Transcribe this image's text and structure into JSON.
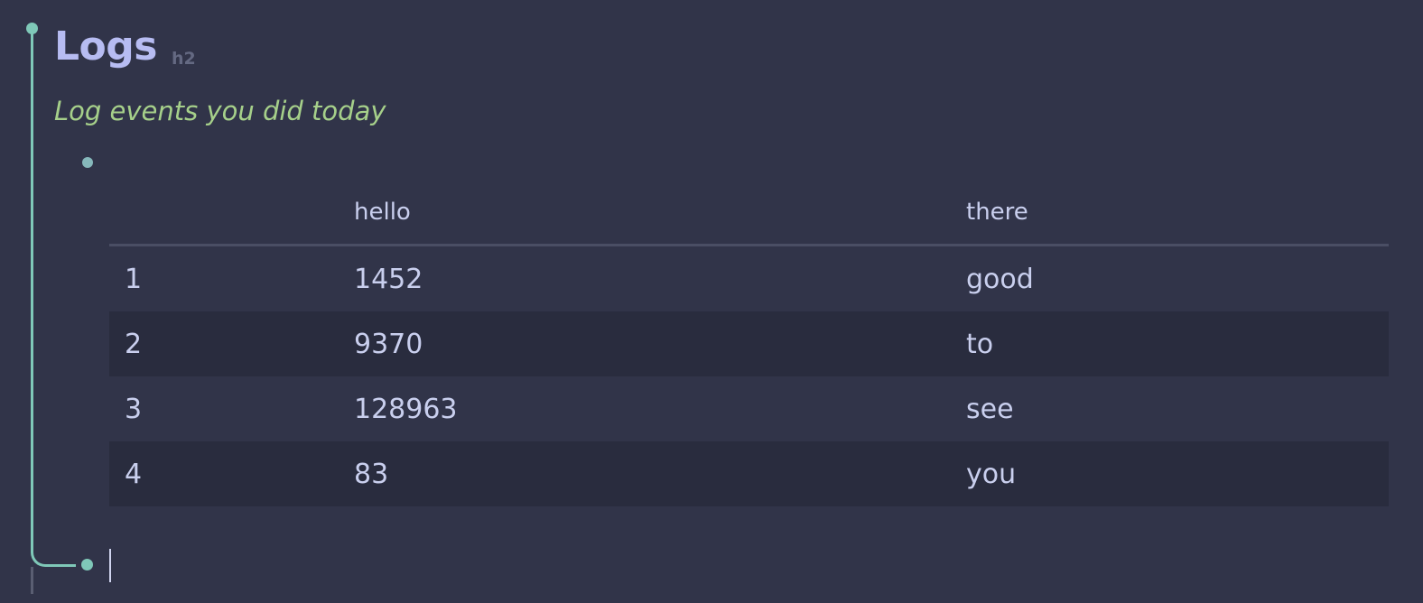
{
  "section": {
    "heading": "Logs",
    "heading_level": "h2",
    "subtitle": "Log events you did today"
  },
  "table": {
    "columns": [
      "",
      "hello",
      "there"
    ],
    "rows": [
      {
        "index": "1",
        "hello": "1452",
        "there": "good"
      },
      {
        "index": "2",
        "hello": "9370",
        "there": "to"
      },
      {
        "index": "3",
        "hello": "128963",
        "there": "see"
      },
      {
        "index": "4",
        "hello": "83",
        "there": "you"
      }
    ]
  },
  "colors": {
    "background": "#313449",
    "guide": "#7fc8b8",
    "heading": "#b7bcf2",
    "subtitle": "#a6d08a",
    "text": "#c9cfee",
    "alt_row": "#292c3e"
  }
}
